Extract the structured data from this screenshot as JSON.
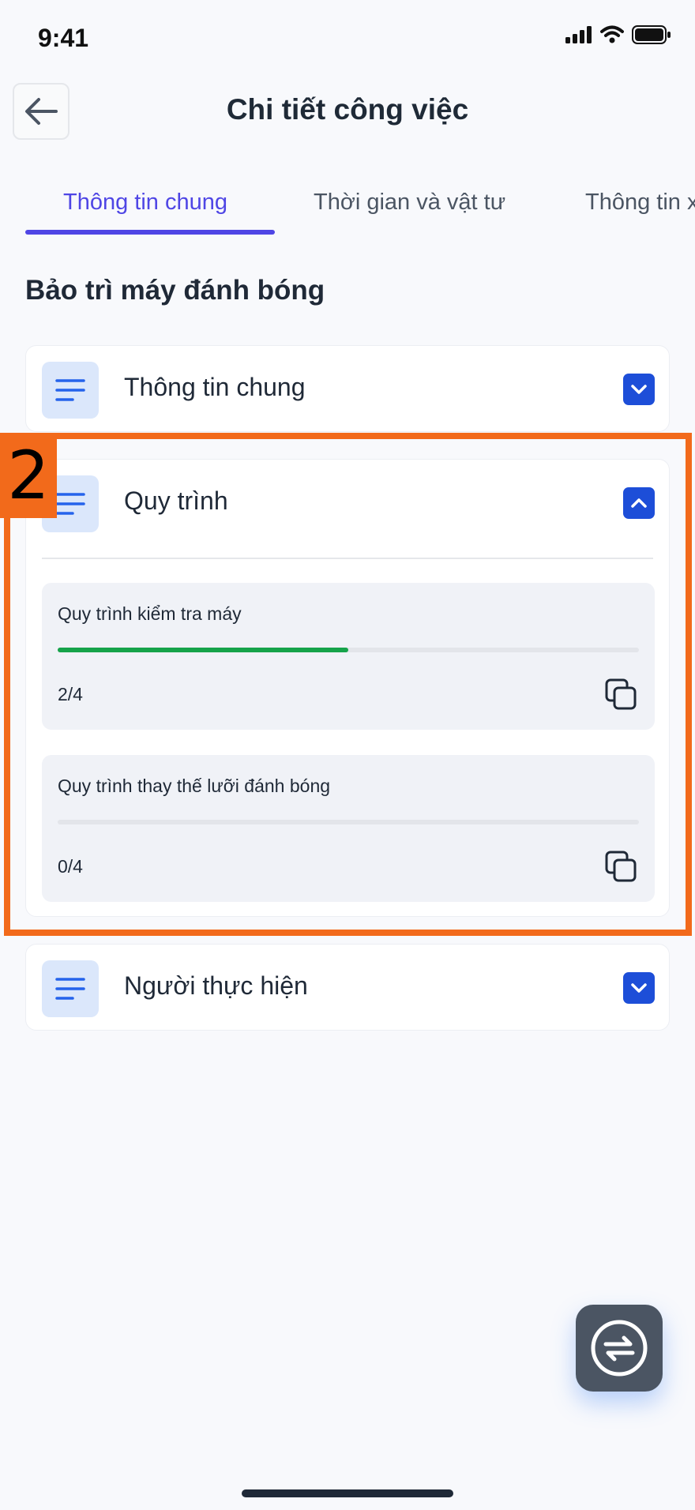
{
  "status_bar": {
    "time": "9:41"
  },
  "header": {
    "title": "Chi tiết công việc"
  },
  "tabs": [
    {
      "label": "Thông tin chung",
      "active": true
    },
    {
      "label": "Thời gian và vật tư",
      "active": false
    },
    {
      "label": "Thông tin x",
      "active": false
    }
  ],
  "job": {
    "title": "Bảo trì máy đánh bóng"
  },
  "sections": [
    {
      "label": "Thông tin chung",
      "expanded": false
    },
    {
      "label": "Quy trình",
      "expanded": true
    },
    {
      "label": "Người thực hiện",
      "expanded": false
    }
  ],
  "procedures": [
    {
      "name": "Quy trình kiểm tra máy",
      "count": "2/4",
      "progress": 0.5
    },
    {
      "name": "Quy trình thay thế lưỡi đánh bóng",
      "count": "0/4",
      "progress": 0
    }
  ],
  "annotation": {
    "badge": "2"
  },
  "colors": {
    "accent": "#4f46e5",
    "primary_button": "#1d4ed8",
    "progress": "#16a34a",
    "highlight": "#f26a1b",
    "fab": "#4b5563"
  },
  "icons": {
    "back": "arrow-left-icon",
    "section": "menu-lines-icon",
    "collapsed": "chevron-down-icon",
    "expanded": "chevron-up-icon",
    "copy": "copy-icon",
    "fab": "sync-icon"
  }
}
